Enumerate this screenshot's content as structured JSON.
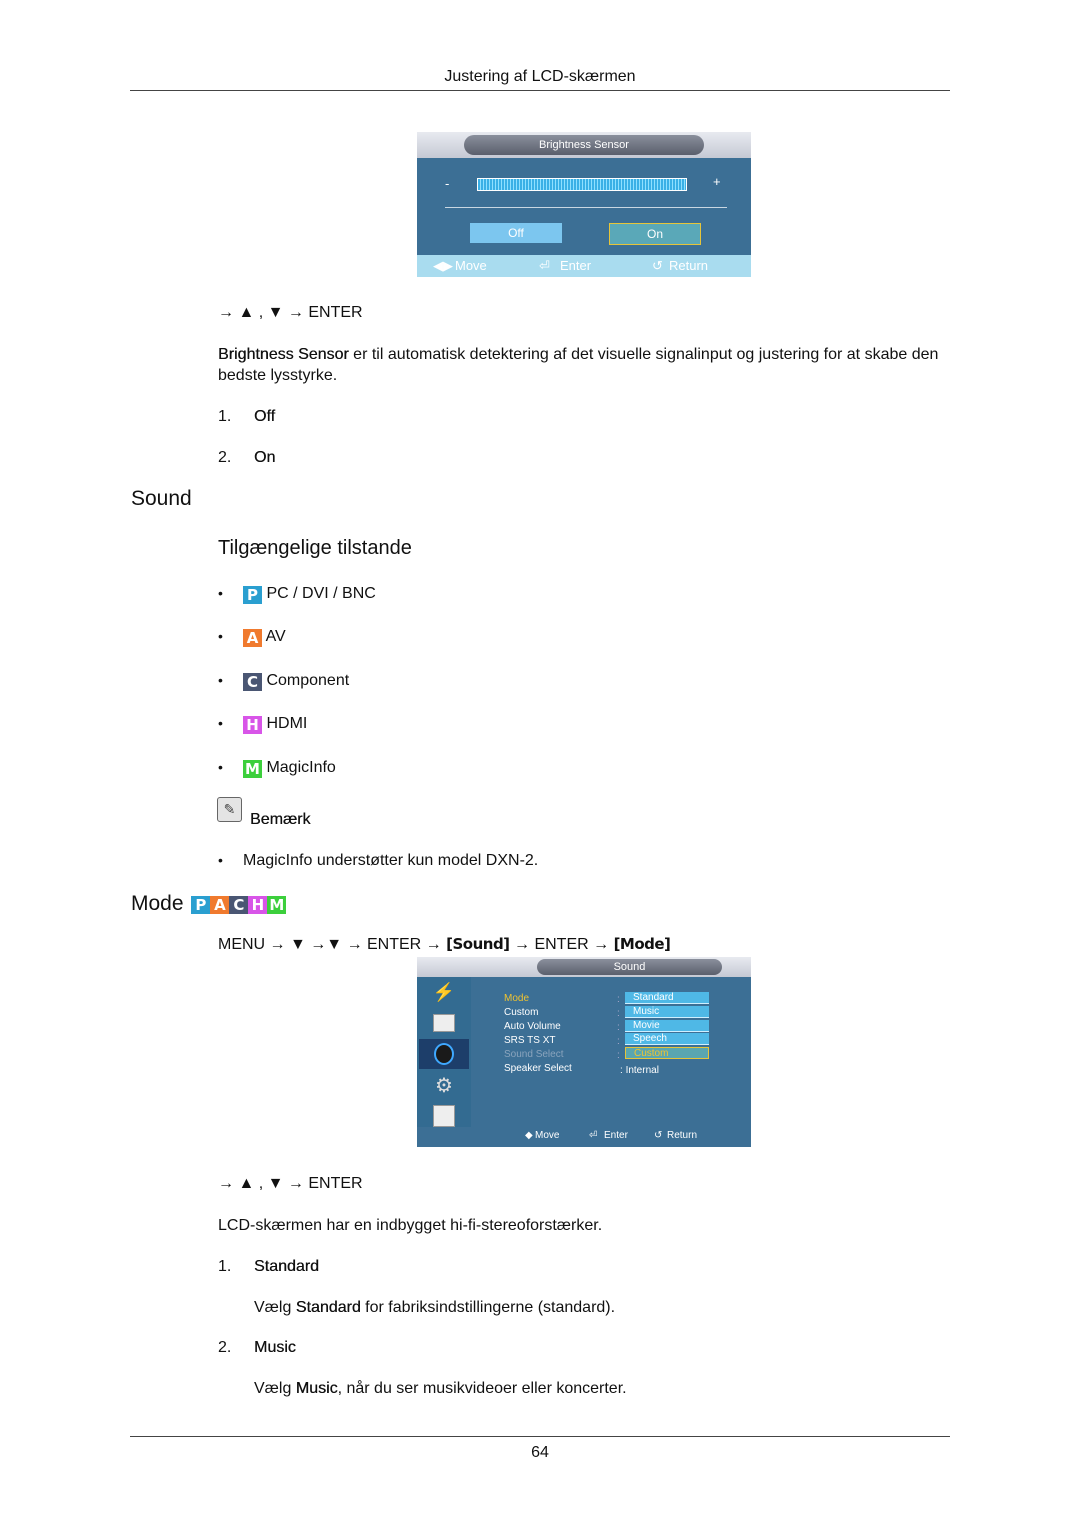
{
  "header": {
    "title": "Justering af LCD-skærmen"
  },
  "brightness_osd": {
    "title": "Brightness Sensor",
    "minus": "-",
    "plus": "+",
    "options": [
      "Off",
      "On"
    ],
    "selected": "On",
    "footer": {
      "move": "Move",
      "enter": "Enter",
      "return": "Return"
    }
  },
  "nav1": {
    "text": "→ ▲ , ▼ → ENTER"
  },
  "brightness_desc": {
    "term": "Brightness Sensor",
    "text": "  er til automatisk detektering af det visuelle signalinput og justering for at skabe den bedste lysstyrke."
  },
  "brightness_list": [
    {
      "num": "1.",
      "label": "Off"
    },
    {
      "num": "2.",
      "label": "On"
    }
  ],
  "sound_section": {
    "title": "Sound",
    "subtitle": "Tilgængelige tilstande",
    "modes": [
      {
        "badge": "P",
        "color": "#2a9fd0",
        "label": "PC / DVI / BNC"
      },
      {
        "badge": "A",
        "color": "#f07a2e",
        "label": "AV"
      },
      {
        "badge": "C",
        "color": "#4a5673",
        "label": "Component"
      },
      {
        "badge": "H",
        "color": "#d855e8",
        "label": "HDMI"
      },
      {
        "badge": "M",
        "color": "#3ccf3c",
        "label": "MagicInfo"
      }
    ],
    "note_label": "Bemærk",
    "note_term": "MagicInfo",
    "note_text": " understøtter kun model DXN-2."
  },
  "mode_section": {
    "title": "Mode",
    "badges": [
      "P",
      "A",
      "C",
      "H",
      "M"
    ],
    "path": {
      "prefix": "MENU → ▼ →▼ → ENTER → ",
      "sound": "[Sound]",
      "middle": " → ENTER → ",
      "mode": "[Mode]"
    }
  },
  "sound_osd": {
    "title": "Sound",
    "menu_items": [
      {
        "label": "Mode",
        "state": "active"
      },
      {
        "label": "Custom",
        "state": "normal"
      },
      {
        "label": "Auto Volume",
        "state": "normal"
      },
      {
        "label": "SRS TS XT",
        "state": "normal"
      },
      {
        "label": "Sound Select",
        "state": "disabled"
      },
      {
        "label": "Speaker Select",
        "state": "normal"
      }
    ],
    "options": [
      "Standard",
      "Music",
      "Movie",
      "Speech",
      "Custom"
    ],
    "selected_option": "Custom",
    "speaker_value": "Internal",
    "footer": {
      "move": "Move",
      "enter": "Enter",
      "return": "Return"
    }
  },
  "nav2": {
    "text": "→ ▲ , ▼ → ENTER"
  },
  "sound_desc": "LCD-skærmen har en indbygget hi-fi-stereoforstærker.",
  "sound_modes": [
    {
      "num": "1.",
      "label": "Standard",
      "desc_pre": "Vælg ",
      "desc_term": "Standard",
      "desc_post": " for fabriksindstillingerne (standard)."
    },
    {
      "num": "2.",
      "label": "Music",
      "desc_pre": "Vælg ",
      "desc_term": "Music",
      "desc_post": ", når du ser musikvideoer eller koncerter."
    }
  ],
  "footer": {
    "page_number": "64"
  }
}
